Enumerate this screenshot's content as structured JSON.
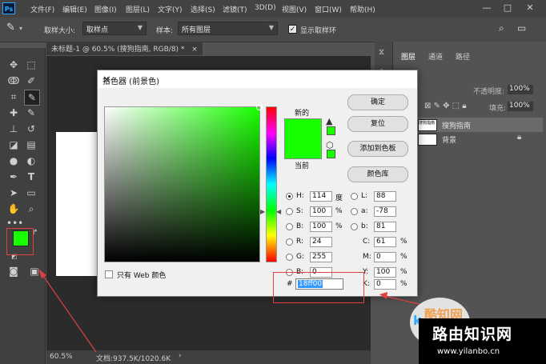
{
  "menubar": {
    "logo": "Ps",
    "items": [
      "文件(F)",
      "编辑(E)",
      "图像(I)",
      "图层(L)",
      "文字(Y)",
      "选择(S)",
      "滤镜(T)",
      "3D(D)",
      "视图(V)",
      "窗口(W)",
      "帮助(H)"
    ],
    "minimize": "—",
    "maximize": "□",
    "close": "✕"
  },
  "options": {
    "sample_size_label": "取样大小:",
    "sample_size_value": "取样点",
    "sample_label": "样本:",
    "sample_value": "所有图层",
    "show_ring_label": "显示取样环",
    "show_ring_checked": true
  },
  "document": {
    "tab_title": "未标题-1 @ 60.5% (搜狗指南, RGB/8) *",
    "tab_close": "×",
    "zoom": "60.5%",
    "doc_info": "文档:937.5K/1020.6K",
    "status_arrow": "›"
  },
  "panels": {
    "tabs": [
      "图层",
      "通道",
      "路径"
    ],
    "active_tab": "图层",
    "opacity_label": "不透明度:",
    "opacity_value": "100%",
    "fill_label": "填充:",
    "fill_value": "100%",
    "layers": [
      {
        "name": "搜狗指南",
        "thumb_text": "搜狗指南"
      },
      {
        "name": "背景",
        "locked": true
      }
    ]
  },
  "dialog": {
    "title": "拾色器 (前景色)",
    "close": "✕",
    "new_label": "新的",
    "current_label": "当前",
    "ok_button": "确定",
    "reset_button": "复位",
    "add_swatch_button": "添加到色板",
    "color_library_button": "颜色库",
    "web_only_label": "只有 Web 颜色",
    "hsb": {
      "H": {
        "label": "H:",
        "value": "114",
        "unit": "度",
        "selected": true
      },
      "S": {
        "label": "S:",
        "value": "100",
        "unit": "%"
      },
      "B": {
        "label": "B:",
        "value": "100",
        "unit": "%"
      }
    },
    "rgb": {
      "R": {
        "label": "R:",
        "value": "24"
      },
      "G": {
        "label": "G:",
        "value": "255"
      },
      "B": {
        "label": "B:",
        "value": "0"
      }
    },
    "lab": {
      "L": {
        "label": "L:",
        "value": "88"
      },
      "a": {
        "label": "a:",
        "value": "-78"
      },
      "b": {
        "label": "b:",
        "value": "81"
      }
    },
    "cmyk": {
      "C": {
        "label": "C:",
        "value": "61",
        "unit": "%"
      },
      "M": {
        "label": "M:",
        "value": "0",
        "unit": "%"
      },
      "Y": {
        "label": "Y:",
        "value": "100",
        "unit": "%"
      },
      "K": {
        "label": "K:",
        "value": "0",
        "unit": "%"
      }
    },
    "hex_label": "#",
    "hex_value": "18ff00"
  },
  "colors": {
    "foreground": "#18ff00",
    "background": "#ffffff",
    "annotation": "#e04040"
  },
  "watermark": {
    "small": "酷知网",
    "main": "路由知识网",
    "url": "www.yilanbo.cn"
  }
}
